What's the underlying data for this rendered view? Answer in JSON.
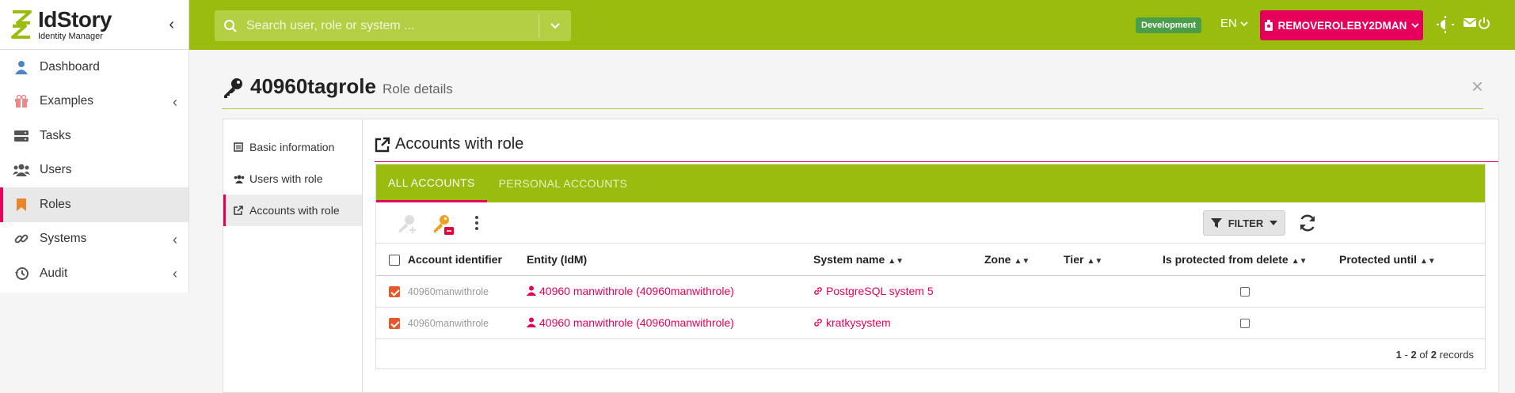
{
  "brand": {
    "title": "IdStory",
    "subtitle": "Identity Manager"
  },
  "sidebar": {
    "items": [
      {
        "label": "Dashboard"
      },
      {
        "label": "Examples"
      },
      {
        "label": "Tasks"
      },
      {
        "label": "Users"
      },
      {
        "label": "Roles"
      },
      {
        "label": "Systems"
      },
      {
        "label": "Audit"
      }
    ]
  },
  "topbar": {
    "search_placeholder": "Search user, role or system ...",
    "env_badge": "Development",
    "language": "EN",
    "user": "REMOVEROLEBY2DMAN"
  },
  "page": {
    "title": "40960tagrole",
    "subtitle": "Role details",
    "section_title": "Accounts with role"
  },
  "subnav": [
    {
      "label": "Basic information"
    },
    {
      "label": "Users with role"
    },
    {
      "label": "Accounts with role"
    }
  ],
  "tabs": [
    {
      "label": "ALL ACCOUNTS"
    },
    {
      "label": "PERSONAL ACCOUNTS"
    }
  ],
  "toolbar": {
    "filter_label": "FILTER"
  },
  "table": {
    "columns": [
      "Account identifier",
      "Entity (IdM)",
      "System name",
      "Zone",
      "Tier",
      "Is protected from delete",
      "Protected until"
    ],
    "rows": [
      {
        "account": "40960manwithrole",
        "entity": "40960 manwithrole (40960manwithrole)",
        "system": "PostgreSQL system 5",
        "zone": "",
        "tier": "",
        "protected_until": ""
      },
      {
        "account": "40960manwithrole",
        "entity": "40960 manwithrole (40960manwithrole)",
        "system": "kratkysystem",
        "zone": "",
        "tier": "",
        "protected_until": ""
      }
    ]
  },
  "pagination": {
    "from": "1",
    "to": "2",
    "of_word": "of",
    "total": "2",
    "records_word": "records"
  },
  "colors": {
    "accent": "#99bc0e",
    "brand_pink": "#e6005c",
    "checkbox_orange": "#e8572a"
  }
}
